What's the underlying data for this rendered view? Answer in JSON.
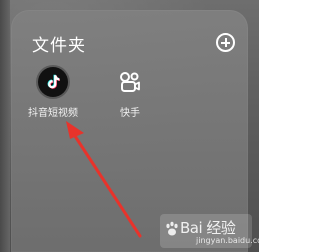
{
  "folder": {
    "title": "文件夹",
    "add_icon": "add-circle-icon"
  },
  "apps": [
    {
      "label": "抖音短视频",
      "icon": "tiktok-icon"
    },
    {
      "label": "快手",
      "icon": "kuaishou-icon"
    }
  ],
  "annotation": {
    "arrow_color": "#e8332b"
  },
  "watermark": {
    "text": "Bai 经验",
    "sub": "jingyan.baidu.com"
  }
}
